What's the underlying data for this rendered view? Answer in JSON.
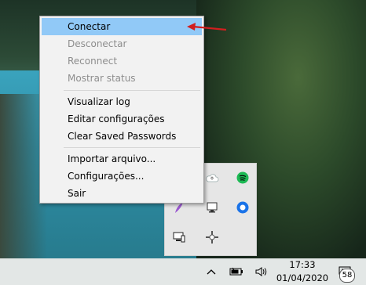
{
  "context_menu": {
    "items": [
      {
        "label": "Conectar",
        "state": "highlighted"
      },
      {
        "label": "Desconectar",
        "state": "disabled"
      },
      {
        "label": "Reconnect",
        "state": "disabled"
      },
      {
        "label": "Mostrar status",
        "state": "disabled"
      },
      {
        "label": "Visualizar log",
        "state": "enabled"
      },
      {
        "label": "Editar configurações",
        "state": "enabled"
      },
      {
        "label": "Clear Saved Passwords",
        "state": "enabled"
      },
      {
        "label": "Importar arquivo...",
        "state": "enabled"
      },
      {
        "label": "Configurações...",
        "state": "enabled"
      },
      {
        "label": "Sair",
        "state": "enabled"
      }
    ]
  },
  "tray_flyout": {
    "icons": [
      "cloud-icon",
      "spotify-icon",
      "feather-icon",
      "network-monitor-icon",
      "browser-icon",
      "computer-icon",
      "openvpn-gui-icon"
    ]
  },
  "taskbar": {
    "icons": [
      "chevron-up-icon",
      "battery-icon",
      "volume-icon",
      "notifications-icon"
    ],
    "time": "17:33",
    "date": "01/04/2020",
    "notification_count": "58"
  },
  "colors": {
    "highlight": "#91c9f7",
    "disabled_text": "#8d8d8d",
    "annotation_arrow": "#d11f1f"
  }
}
